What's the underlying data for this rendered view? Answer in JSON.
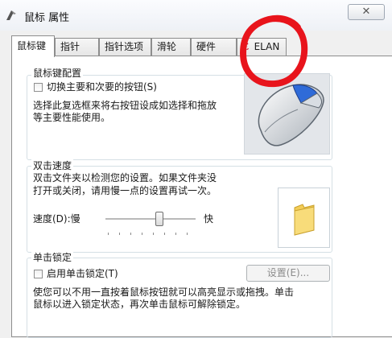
{
  "window": {
    "title": "鼠标 属性",
    "close_label": "✕",
    "title_icon": "mouse-pointer-icon"
  },
  "tabs": [
    {
      "label": "鼠标键",
      "active": true
    },
    {
      "label": "指针",
      "active": false
    },
    {
      "label": "指针选项",
      "active": false
    },
    {
      "label": "滑轮",
      "active": false
    },
    {
      "label": "硬件",
      "active": false
    },
    {
      "label": "ELAN",
      "active": false,
      "icon": "elan-logo-icon"
    }
  ],
  "button_config": {
    "group_title": "鼠标键配置",
    "switch_checkbox_label": "切换主要和次要的按钮(S)",
    "switch_checked": false,
    "description_line1": "选择此复选框来将右按钮设成如选择和拖放",
    "description_line2": "等主要性能使用。",
    "image_icon": "mouse-icon"
  },
  "double_click": {
    "group_title": "双击速度",
    "description_line1": "双击文件夹以检测您的设置。如果文件夹没",
    "description_line2": "打开或关闭，请用慢一点的设置再试一次。",
    "speed_label": "速度(D):慢",
    "fast_label": "快",
    "slider_value_fraction": 0.62,
    "test_icon": "folder-icon"
  },
  "click_lock": {
    "group_title": "单击锁定",
    "enable_checkbox_label": "启用单击锁定(T)",
    "enable_checked": false,
    "settings_button_label": "设置(E)...",
    "description_line1": "使您可以不用一直按着鼠标按钮就可以高亮显示或拖拽。单击",
    "description_line2": "鼠标以进入锁定状态，再次单击鼠标可解除锁定。"
  },
  "colors": {
    "annotation_circle": "#e8141c",
    "elan_logo": "#c8102e",
    "folder": "#f3cd57"
  }
}
